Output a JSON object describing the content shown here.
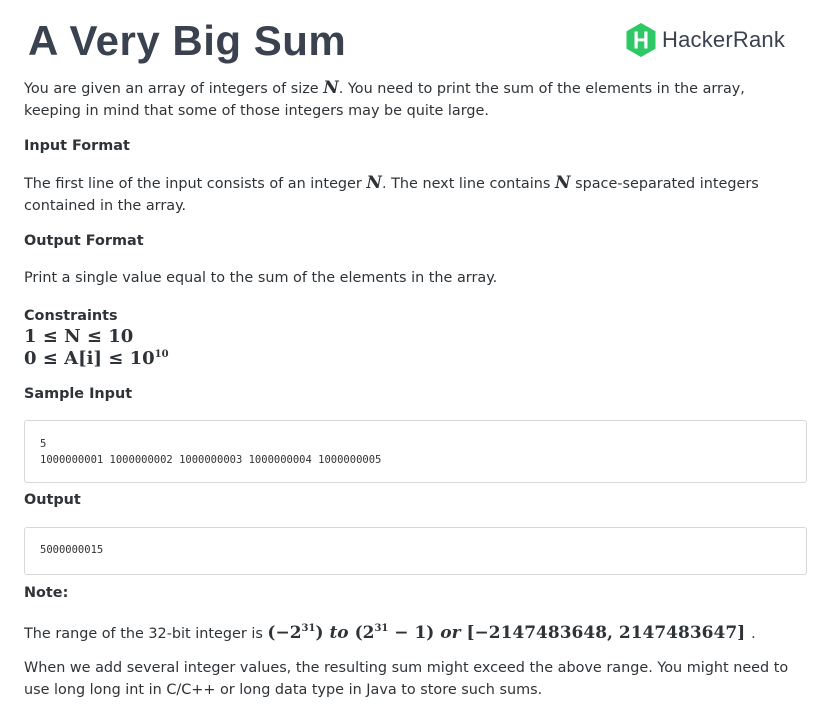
{
  "header": {
    "title": "A Very Big Sum",
    "brand": "HackerRank",
    "brand_color": "#2ec866"
  },
  "intro": {
    "t1": "You are given an array of integers of size",
    "var_n": "N",
    "t2": ". You need to print the sum of the elements in the array,",
    "t3": "keeping in mind that some of those integers may be quite large."
  },
  "input_format": {
    "heading": "Input Format",
    "t1": "The first line of the input consists of an integer",
    "var_n": "N",
    "t2": ". The next line contains",
    "var_n2": "N",
    "t3": "space-separated integers",
    "t4": "contained in the array."
  },
  "output_format": {
    "heading": "Output Format",
    "text": "Print a single value equal to the sum of the elements in the array."
  },
  "constraints": {
    "heading": "Constraints",
    "line1": "1 ≤ N ≤ 10",
    "line2_pre": "0 ≤ A[i] ≤ 10",
    "line2_exp": "10"
  },
  "sample_input": {
    "heading": "Sample Input",
    "lines": [
      "5",
      "1000000001 1000000002 1000000003 1000000004 1000000005"
    ]
  },
  "sample_output": {
    "heading": "Output",
    "value": "5000000015"
  },
  "note": {
    "heading": "Note:",
    "range_pre": "The range of the 32-bit integer is",
    "m1a": "(−2",
    "m1exp": "31",
    "m1b": ")",
    "to_word": "to",
    "m2a": "(2",
    "m2exp": "31",
    "m2b": " − 1)",
    "or_word": "or",
    "m3": "[−2147483648, 2147483647]",
    "range_end": ".",
    "para2_l1": "When we add several integer values, the resulting sum might exceed the above range. You might need to",
    "para2_l2": "use long long int in C/C++ or long data type in Java to store such sums."
  }
}
